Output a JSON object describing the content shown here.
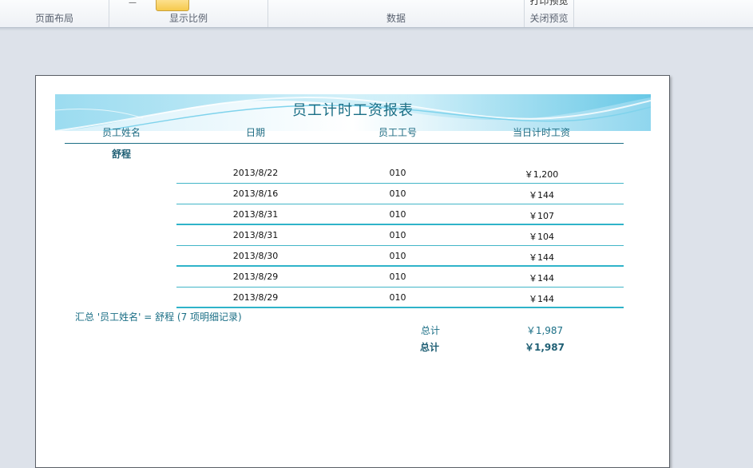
{
  "ribbon": {
    "groups": [
      {
        "label": "页面布局"
      },
      {
        "label": "显示比例"
      },
      {
        "label": "数据"
      },
      {
        "label": "关闭预览",
        "top_text": "打印预览"
      }
    ]
  },
  "report": {
    "title": "员工计时工资报表",
    "columns": [
      "员工姓名",
      "日期",
      "员工工号",
      "当日计时工资"
    ],
    "group_name": "舒程",
    "rows": [
      {
        "date": "2013/8/22",
        "id": "010",
        "wage": "￥1,200"
      },
      {
        "date": "2013/8/16",
        "id": "010",
        "wage": "￥144"
      },
      {
        "date": "2013/8/31",
        "id": "010",
        "wage": "￥107"
      },
      {
        "date": "2013/8/31",
        "id": "010",
        "wage": "￥104"
      },
      {
        "date": "2013/8/30",
        "id": "010",
        "wage": "￥144"
      },
      {
        "date": "2013/8/29",
        "id": "010",
        "wage": "￥144"
      },
      {
        "date": "2013/8/29",
        "id": "010",
        "wage": "￥144"
      }
    ],
    "summary": "汇总 '员工姓名' =  舒程 (7 项明细记录)",
    "group_total_label": "总计",
    "group_total_value": "￥1,987",
    "grand_total_label": "总计",
    "grand_total_value": "￥1,987"
  },
  "colors": {
    "accent": "#1b6f86",
    "row_rule": "#42b6c8",
    "zoom_icon": "#f6c94d"
  }
}
